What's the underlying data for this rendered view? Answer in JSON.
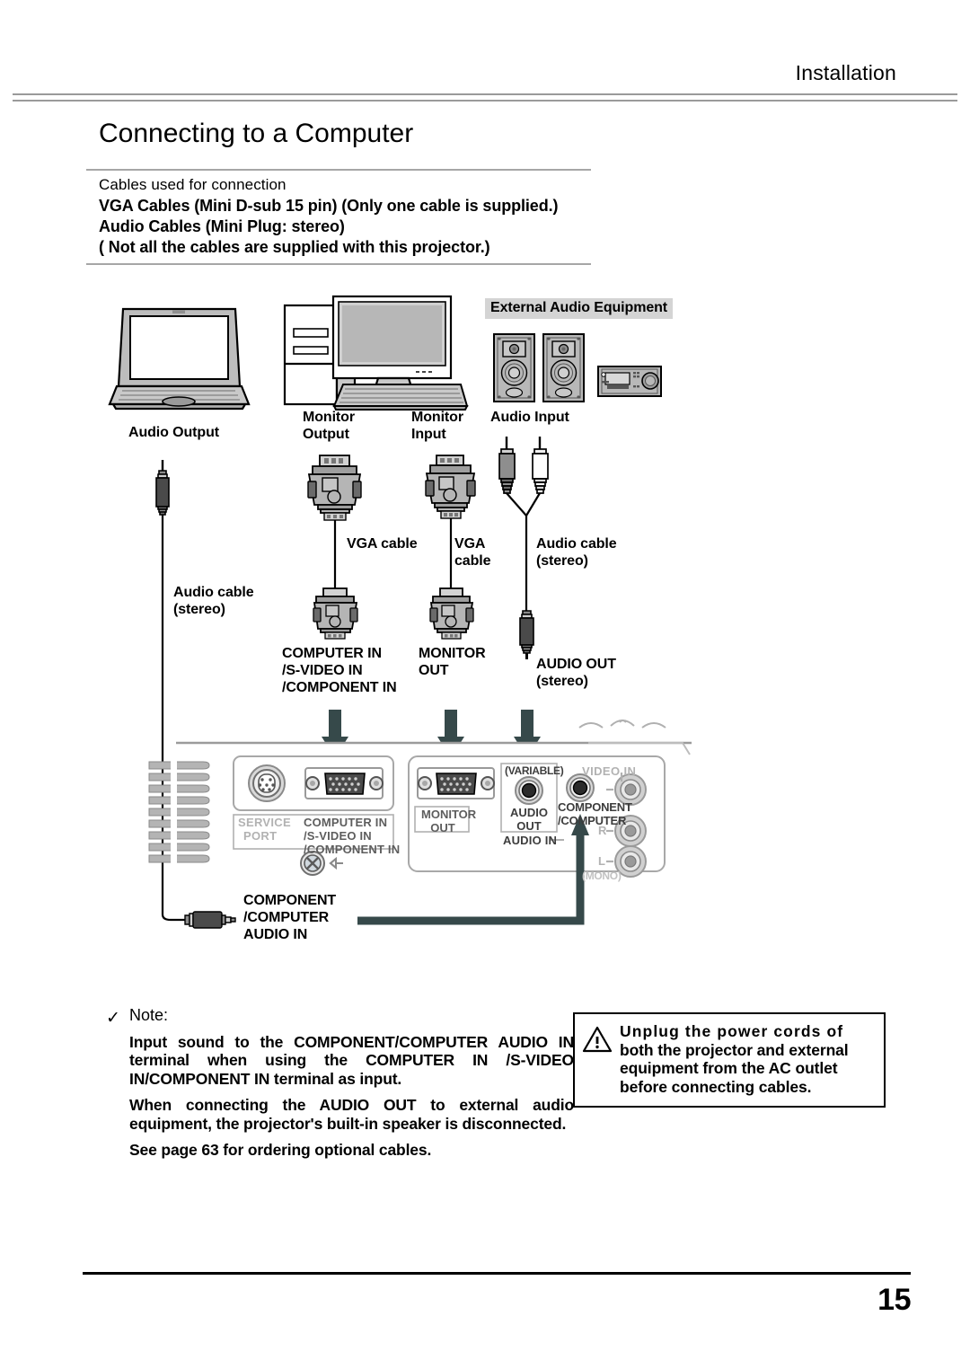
{
  "header": {
    "section_title": "Installation"
  },
  "page_title": "Connecting to a Computer",
  "cables_box": {
    "intro": "Cables used for connection",
    "lines": [
      "VGA Cables (Mini D-sub 15 pin)  (Only one cable is supplied.)",
      "Audio Cables (Mini Plug: stereo)",
      "( Not all the cables are supplied with this projector.)"
    ]
  },
  "diagram": {
    "ext_audio_heading": "External Audio Equipment",
    "device_labels": {
      "laptop_audio_output": "Audio Output",
      "desktop_monitor_output_l1": "Monitor",
      "desktop_monitor_output_l2": "Output",
      "monitor_input_l1": "Monitor",
      "monitor_input_l2": "Input",
      "audio_input": "Audio Input"
    },
    "cable_labels": {
      "audio_cable_left_l1": "Audio cable",
      "audio_cable_left_l2": "(stereo)",
      "vga_cable_1": "VGA cable",
      "vga_cable_2_l1": "VGA",
      "vga_cable_2_l2": "cable",
      "audio_cable_right_l1": "Audio cable",
      "audio_cable_right_l2": "(stereo)"
    },
    "terminal_callouts": {
      "computer_in_l1": "COMPUTER IN",
      "computer_in_l2": "/S-VIDEO IN",
      "computer_in_l3": "/COMPONENT IN",
      "monitor_out_l1": "MONITOR",
      "monitor_out_l2": "OUT",
      "audio_out_l1": "AUDIO OUT",
      "audio_out_l2": "(stereo)",
      "component_audio_in_l1": "COMPONENT",
      "component_audio_in_l2": "/COMPUTER",
      "component_audio_in_l3": "AUDIO IN"
    },
    "panel_print": {
      "service_port_l1": "SERVICE",
      "service_port_l2": "PORT",
      "computer_in_l1": "COMPUTER  IN",
      "computer_in_l2": "/S-VIDEO  IN",
      "computer_in_l3": "/COMPONENT  IN",
      "monitor_out_l1": "MONITOR",
      "monitor_out_l2": "OUT",
      "variable": "(VARIABLE)",
      "audio_out_l1": "AUDIO",
      "audio_out_l2": "OUT",
      "component_computer_l1": "COMPONENT",
      "component_computer_l2": "/COMPUTER",
      "audio_in": "AUDIO  IN",
      "video_in": "VIDEO  IN",
      "ch_r": "R",
      "ch_l": "L",
      "mono": "(MONO)"
    }
  },
  "note": {
    "check_glyph": "✓",
    "label": "Note:",
    "paragraph_1": "Input sound to the COMPONENT/COMPUTER AUDIO IN terminal when using the COMPUTER IN /S-VIDEO IN/COMPONENT IN terminal as input.",
    "paragraph_2": "When connecting the AUDIO OUT to external audio equipment, the projector's built-in speaker is disconnected.",
    "paragraph_3": "See page 63 for ordering optional cables."
  },
  "warning": {
    "line_1": "Unplug the power cords of",
    "line_2": "both the projector and external",
    "line_3": "equipment from the AC outlet",
    "line_4": "before connecting cables."
  },
  "footer": {
    "page_number": "15"
  },
  "colors": {
    "rule_gray": "#9a9a9a",
    "device_gray": "#b5b5b5",
    "panel_gray": "#d9d9d9",
    "arrow_dark": "#36494a",
    "highlight_gray": "#d4d4d4"
  }
}
